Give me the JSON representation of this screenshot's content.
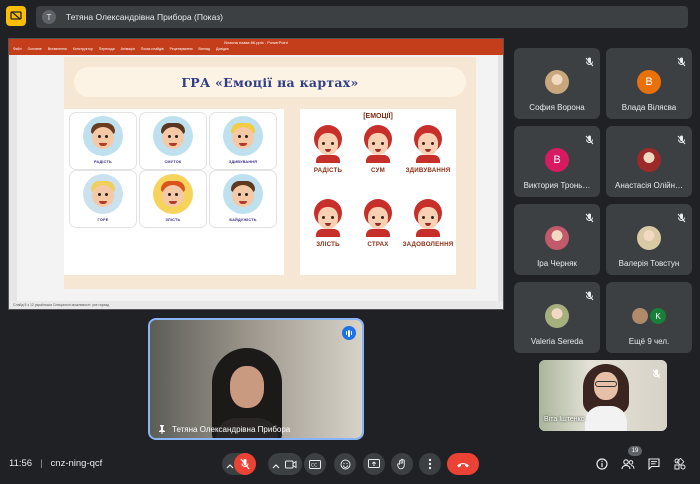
{
  "header": {
    "presenter_initial": "T",
    "presenter_title": "Тетяна Олександрівна Прибора (Показ)"
  },
  "ppt": {
    "window_title": "Власна назва 86.pptx - PowerPoint",
    "menu": [
      "Файл",
      "Основне",
      "Вставлення",
      "Конструктор",
      "Переходи",
      "Анімація",
      "Показ слайдів",
      "Рецензування",
      "Вигляд",
      "Довідка"
    ],
    "status": "Слайд 5 з 12   українська   Спеціальні можливості: усе гаразд"
  },
  "slide": {
    "title": "ГРА «Емоції на картах»",
    "emotions_heading": "[ЕМОЦІЇ]",
    "cards": [
      {
        "label": "РАДІСТЬ",
        "hair": "#6b3b1f",
        "bg": "#bfe1ef"
      },
      {
        "label": "СМУТОК",
        "hair": "#5a3521",
        "bg": "#bfe1ef"
      },
      {
        "label": "ЗДИВУВАННЯ",
        "hair": "#f3cc44",
        "bg": "#bfe1ef"
      },
      {
        "label": "ГОРЕ",
        "hair": "#f0cf5a",
        "bg": "#cbe2ee"
      },
      {
        "label": "ЗЛІСТЬ",
        "hair": "#d9531e",
        "bg": "#f6d35a"
      },
      {
        "label": "БАЙДУЖІСТЬ",
        "hair": "#5e3a20",
        "bg": "#bfe1ef"
      }
    ],
    "emotions": [
      "РАДІСТЬ",
      "СУМ",
      "ЗДИВУВАННЯ",
      "ЗЛІСТЬ",
      "СТРАХ",
      "ЗАДОВОЛЕННЯ"
    ]
  },
  "main_tile": {
    "name": "Тетяна Олександрівна Прибора"
  },
  "participants": [
    {
      "name": "София Ворона",
      "initial": "",
      "color": "#c9a77c"
    },
    {
      "name": "Влада Вілясва",
      "initial": "B",
      "color": "#e8710a"
    },
    {
      "name": "Виктория Тронь…",
      "initial": "B",
      "color": "#d81b60"
    },
    {
      "name": "Анастасія Олійн…",
      "initial": "",
      "color": "#9c2a2a"
    },
    {
      "name": "Іра Черняк",
      "initial": "",
      "color": "#c25a6b"
    },
    {
      "name": "Валерія Товстун",
      "initial": "",
      "color": "#d9c9a5"
    },
    {
      "name": "Valeria Sereda",
      "initial": "",
      "color": "#a6b07e"
    },
    {
      "name": "Ещё 9 чел.",
      "initial": "K",
      "color": "#188038"
    }
  ],
  "self_tile": {
    "name": "Віта Іштенко"
  },
  "bottom_bar": {
    "time": "11:56",
    "separator": "|",
    "meeting_code": "cnz-ning-qcf",
    "participant_count": "19"
  },
  "colors": {
    "accent_blue": "#8ab4f8",
    "mute_red": "#ea4335",
    "tile_bg": "#3c4043",
    "present_yellow": "#fbbc04"
  }
}
